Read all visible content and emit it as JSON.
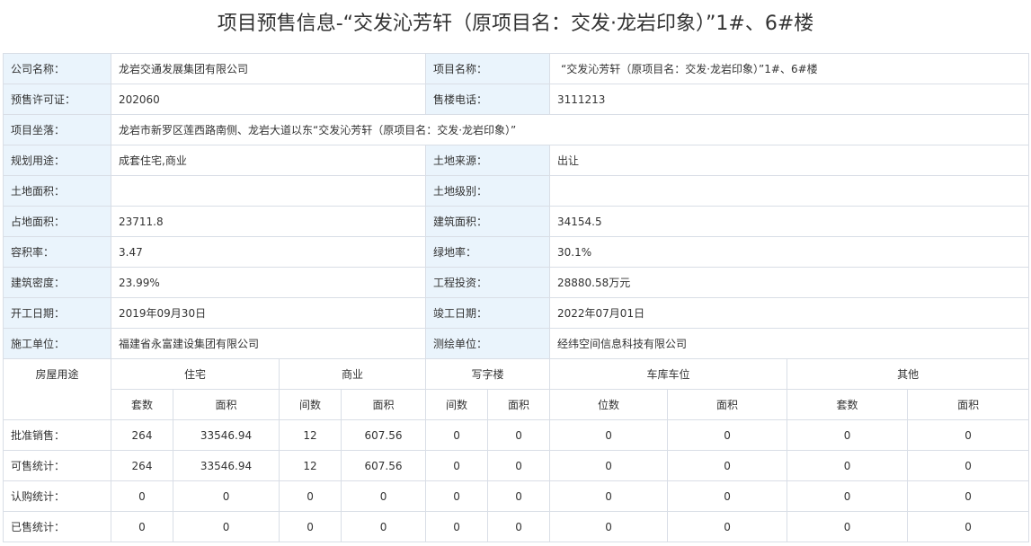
{
  "title": "项目预售信息-“交发沁芳轩（原项目名：交发·龙岩印象）”1#、6#楼",
  "info": {
    "company": {
      "label": "公司名称：",
      "value": "龙岩交通发展集团有限公司"
    },
    "project_name": {
      "label": "项目名称：",
      "value": "“交发沁芳轩（原项目名：交发·龙岩印象）”1#、6#楼"
    },
    "permit": {
      "label": "预售许可证：",
      "value": "202060"
    },
    "phone": {
      "label": "售楼电话：",
      "value": "3111213"
    },
    "location": {
      "label": "项目坐落：",
      "value": "龙岩市新罗区莲西路南侧、龙岩大道以东“交发沁芳轩（原项目名：交发·龙岩印象）”"
    },
    "usage": {
      "label": "规划用途：",
      "value": "成套住宅,商业"
    },
    "land_source": {
      "label": "土地来源：",
      "value": "出让"
    },
    "land_area": {
      "label": "土地面积：",
      "value": ""
    },
    "land_grade": {
      "label": "土地级别：",
      "value": ""
    },
    "site_area": {
      "label": "占地面积：",
      "value": "23711.8"
    },
    "floor_area": {
      "label": "建筑面积：",
      "value": "34154.5"
    },
    "plot_ratio": {
      "label": "容积率：",
      "value": "3.47"
    },
    "green_ratio": {
      "label": "绿地率：",
      "value": "30.1%"
    },
    "density": {
      "label": "建筑密度：",
      "value": "23.99%"
    },
    "investment": {
      "label": "工程投资：",
      "value": "28880.58万元"
    },
    "start_date": {
      "label": "开工日期：",
      "value": "2019年09月30日"
    },
    "end_date": {
      "label": "竣工日期：",
      "value": "2022年07月01日"
    },
    "builder": {
      "label": "施工单位：",
      "value": "福建省永富建设集团有限公司"
    },
    "surveyor": {
      "label": "测绘单位：",
      "value": "经纬空间信息科技有限公司"
    }
  },
  "stats": {
    "usage_header": "房屋用途",
    "groups": [
      "住宅",
      "商业",
      "写字楼",
      "车库车位",
      "其他"
    ],
    "subheaders": [
      "套数",
      "面积",
      "间数",
      "面积",
      "间数",
      "面积",
      "位数",
      "面积",
      "套数",
      "面积"
    ],
    "rows": [
      {
        "label": "批准销售：",
        "values": [
          "264",
          "33546.94",
          "12",
          "607.56",
          "0",
          "0",
          "0",
          "0",
          "0",
          "0"
        ]
      },
      {
        "label": "可售统计：",
        "values": [
          "264",
          "33546.94",
          "12",
          "607.56",
          "0",
          "0",
          "0",
          "0",
          "0",
          "0"
        ]
      },
      {
        "label": "认购统计：",
        "values": [
          "0",
          "0",
          "0",
          "0",
          "0",
          "0",
          "0",
          "0",
          "0",
          "0"
        ]
      },
      {
        "label": "已售统计：",
        "values": [
          "0",
          "0",
          "0",
          "0",
          "0",
          "0",
          "0",
          "0",
          "0",
          "0"
        ]
      }
    ]
  },
  "colors": {
    "label_bg": "#eaf4fc",
    "border": "#d9dee6",
    "text": "#333333"
  }
}
